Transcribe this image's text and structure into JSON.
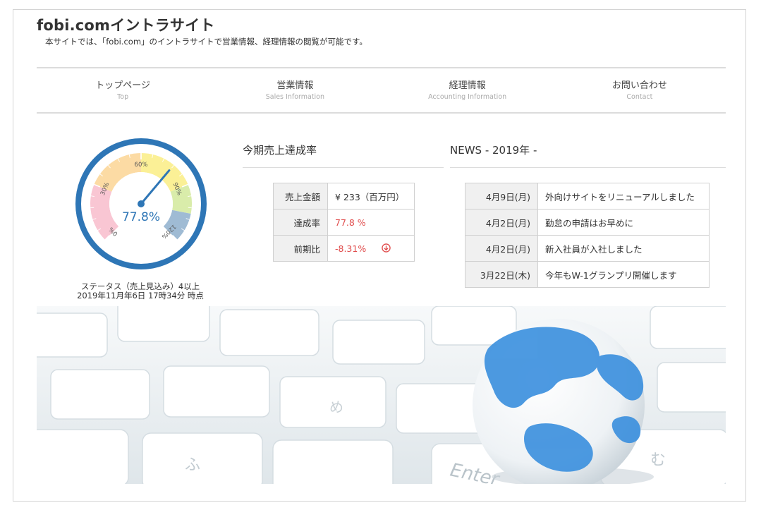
{
  "site": {
    "title": "fobi.comイントラサイト",
    "description": "本サイトでは、「fobi.com」のイントラサイトで営業情報、経理情報の閲覧が可能です。"
  },
  "nav": [
    {
      "label": "トップページ",
      "sub": "Top"
    },
    {
      "label": "営業情報",
      "sub": "Sales Information"
    },
    {
      "label": "経理情報",
      "sub": "Accounting Information"
    },
    {
      "label": "お問い合わせ",
      "sub": "Contact"
    }
  ],
  "gauge": {
    "value_text": "77.8%",
    "value": 77.8,
    "tick_labels": [
      "0%",
      "30%",
      "60%",
      "90%",
      "120%"
    ],
    "status_line1": "ステータス（売上見込み）4以上",
    "status_line2": "2019年11月年6日 17時34分 時点",
    "colors": {
      "ring": "#2e76b6",
      "band_0_30": "#f9c6d3",
      "band_30_60": "#fcdba4",
      "band_60_90": "#fbf096",
      "band_90_120": "#d9ecaa",
      "band_120": "#9fbbd4",
      "needle": "#2e76b6"
    }
  },
  "sales": {
    "heading": "今期売上達成率",
    "rows": [
      {
        "label": "売上金額",
        "value": "¥ 233（百万円）"
      },
      {
        "label": "達成率",
        "value": "77.8 %"
      },
      {
        "label": "前期比",
        "value": "-8.31%"
      }
    ],
    "trend_icon": "arrow-down-circle-icon",
    "accent": "#e04b4b"
  },
  "news": {
    "heading": "NEWS - 2019年 -",
    "items": [
      {
        "date": "4月9日(月)",
        "text": "外向けサイトをリニューアルしました"
      },
      {
        "date": "4月2日(月)",
        "text": "勤怠の申請はお早めに"
      },
      {
        "date": "4月2日(月)",
        "text": "新入社員が入社しました"
      },
      {
        "date": "3月22日(木)",
        "text": "今年もW-1グランプリ開催します"
      }
    ]
  },
  "banner": {
    "key_label": "Enter",
    "key_kana": [
      "ふ",
      "め",
      "む"
    ]
  }
}
